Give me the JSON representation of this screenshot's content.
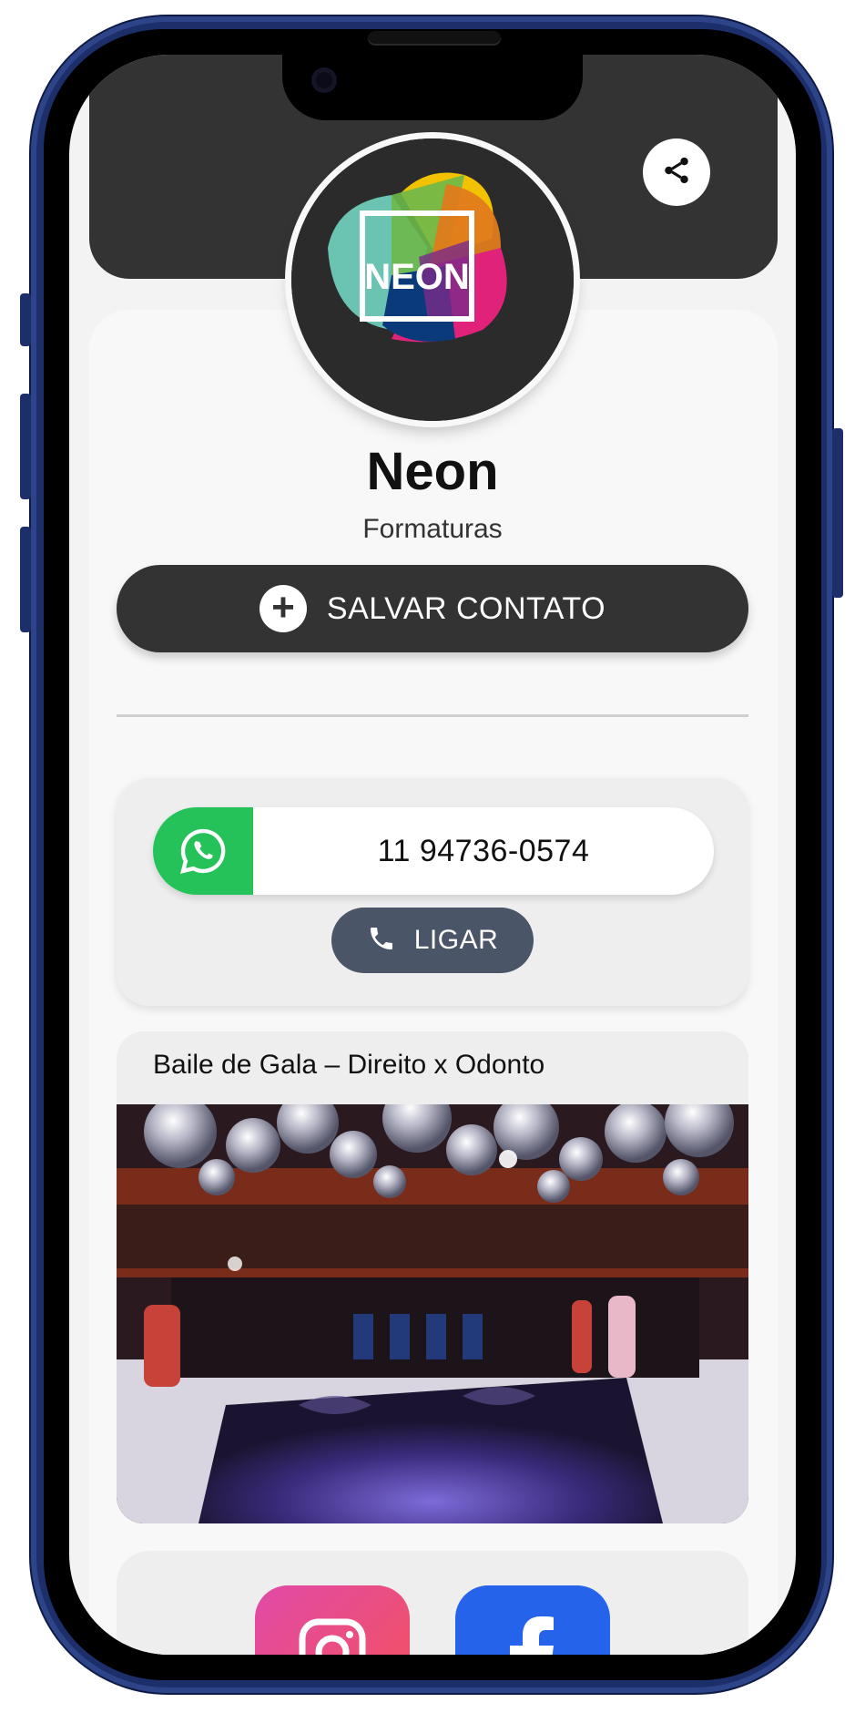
{
  "profile": {
    "name": "Neon",
    "subtitle": "Formaturas",
    "logo_text": "NEON"
  },
  "actions": {
    "save_contact_label": "SALVAR CONTATO",
    "call_label": "LIGAR"
  },
  "whatsapp": {
    "number": "11 94736-0574"
  },
  "event": {
    "title": "Baile de Gala – Direito x Odonto"
  },
  "icons": {
    "share": "share-icon",
    "plus": "plus-icon",
    "whatsapp": "whatsapp-icon",
    "phone": "phone-icon",
    "instagram": "instagram-icon",
    "facebook": "facebook-icon"
  },
  "colors": {
    "header": "#333333",
    "whatsapp_green": "#25c25a",
    "call_button": "#4a5568",
    "facebook_blue": "#2563eb",
    "phone_frame": "#1d2f6b"
  }
}
